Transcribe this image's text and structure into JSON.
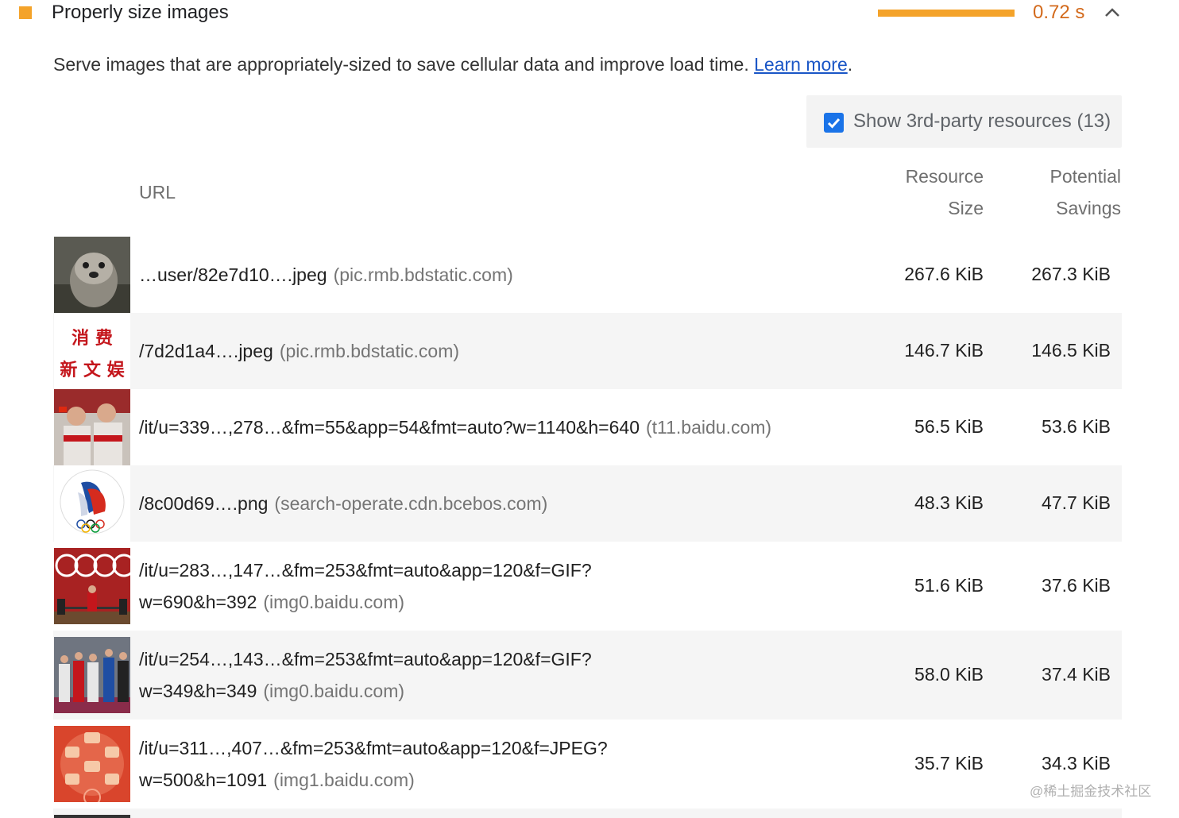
{
  "audit": {
    "title": "Properly size images",
    "value": "0.72 s",
    "description": "Serve images that are appropriately-sized to save cellular data and improve load time.",
    "learn_more": "Learn more",
    "period": ".",
    "accent_color": "#f4a32a"
  },
  "filter": {
    "label": "Show 3rd-party resources (13)",
    "checked": true
  },
  "table": {
    "headers": {
      "url": "URL",
      "size_line1": "Resource",
      "size_line2": "Size",
      "savings_line1": "Potential",
      "savings_line2": "Savings"
    },
    "rows": [
      {
        "url": "…user/82e7d10….jpeg",
        "url2": "",
        "origin": "(pic.rmb.bdstatic.com)",
        "size": "267.6 KiB",
        "savings": "267.3 KiB",
        "thumb": "otter-photo"
      },
      {
        "url": "/7d2d1a4….jpeg",
        "url2": "",
        "origin": "(pic.rmb.bdstatic.com)",
        "size": "146.7 KiB",
        "savings": "146.5 KiB",
        "thumb": "chinese-text-logo",
        "thumb_text_top": "消 费",
        "thumb_text_bottom": "新 文 娱"
      },
      {
        "url": "/it/u=339…,278…&fm=55&app=54&fmt=auto?w=1140&h=640",
        "url2": "",
        "origin": "(t11.baidu.com)",
        "size": "56.5 KiB",
        "savings": "53.6 KiB",
        "thumb": "badminton-players-photo"
      },
      {
        "url": "/8c00d69….png",
        "url2": "",
        "origin": "(search-operate.cdn.bcebos.com)",
        "size": "48.3 KiB",
        "savings": "47.7 KiB",
        "thumb": "russian-olympic-committee-logo"
      },
      {
        "url": "/it/u=283…,147…&fm=253&fmt=auto&app=120&f=GIF?",
        "url2": "w=690&h=392",
        "origin": "(img0.baidu.com)",
        "size": "51.6 KiB",
        "savings": "37.6 KiB",
        "thumb": "weightlifting-photo"
      },
      {
        "url": "/it/u=254…,143…&fm=253&fmt=auto&app=120&f=GIF?",
        "url2": "w=349&h=349",
        "origin": "(img0.baidu.com)",
        "size": "58.0 KiB",
        "savings": "37.4 KiB",
        "thumb": "podium-photo"
      },
      {
        "url": "/it/u=311…,407…&fm=253&fmt=auto&app=120&f=JPEG?",
        "url2": "w=500&h=1091",
        "origin": "(img1.baidu.com)",
        "size": "35.7 KiB",
        "savings": "34.3 KiB",
        "thumb": "red-poster-image"
      }
    ]
  },
  "watermark": "@稀土掘金技术社区"
}
